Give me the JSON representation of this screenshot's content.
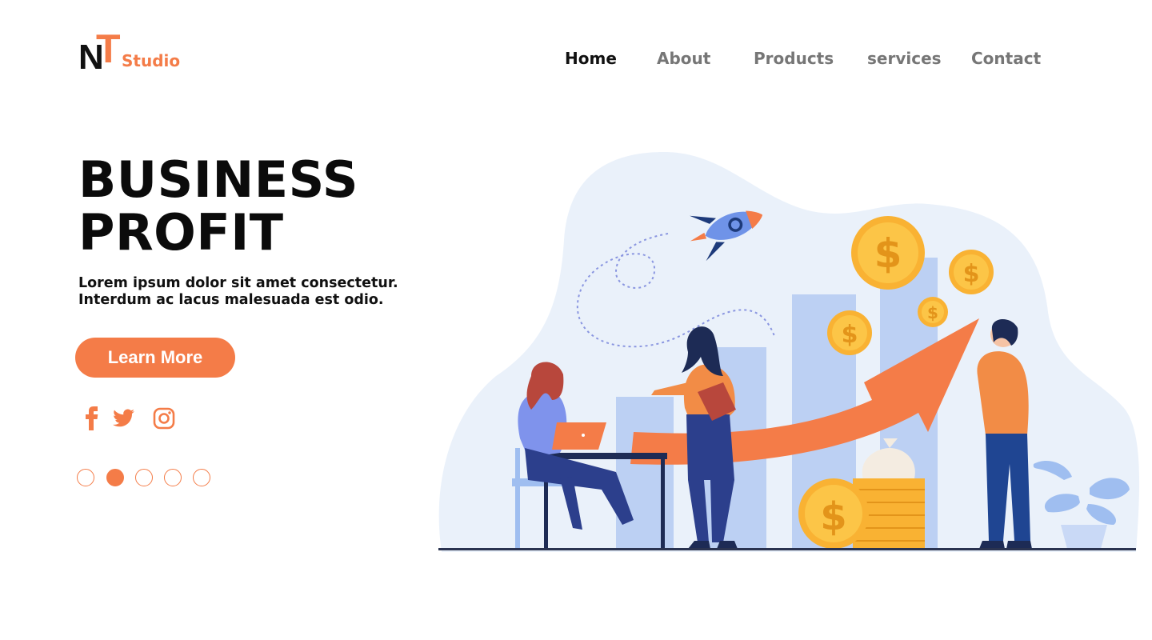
{
  "brand": {
    "logo_n": "N",
    "logo_t": "T",
    "logo_studio": "Studio",
    "accent": "#f47c48"
  },
  "nav": [
    {
      "label": "Home",
      "active": true
    },
    {
      "label": "About",
      "active": false
    },
    {
      "label": "Products",
      "active": false
    },
    {
      "label": "services",
      "active": false
    },
    {
      "label": "Contact",
      "active": false
    }
  ],
  "hero": {
    "title_line1": "BUSINESS",
    "title_line2": "PROFIT",
    "sub_line1": "Lorem ipsum dolor sit amet consectetur.",
    "sub_line2": "Interdum ac lacus malesuada est odio.",
    "cta_label": "Learn More"
  },
  "social": [
    {
      "icon": "facebook-icon"
    },
    {
      "icon": "twitter-icon"
    },
    {
      "icon": "instagram-icon"
    }
  ],
  "slider": {
    "total": 5,
    "active_index": 1
  },
  "illustration": {
    "subject": "business-growth-illustration",
    "colors": {
      "blob": "#eaf1fa",
      "bars": "#bcd0f3",
      "arrow": "#f47c48",
      "coin": "#f9b233",
      "navy": "#1d3a7a"
    }
  }
}
